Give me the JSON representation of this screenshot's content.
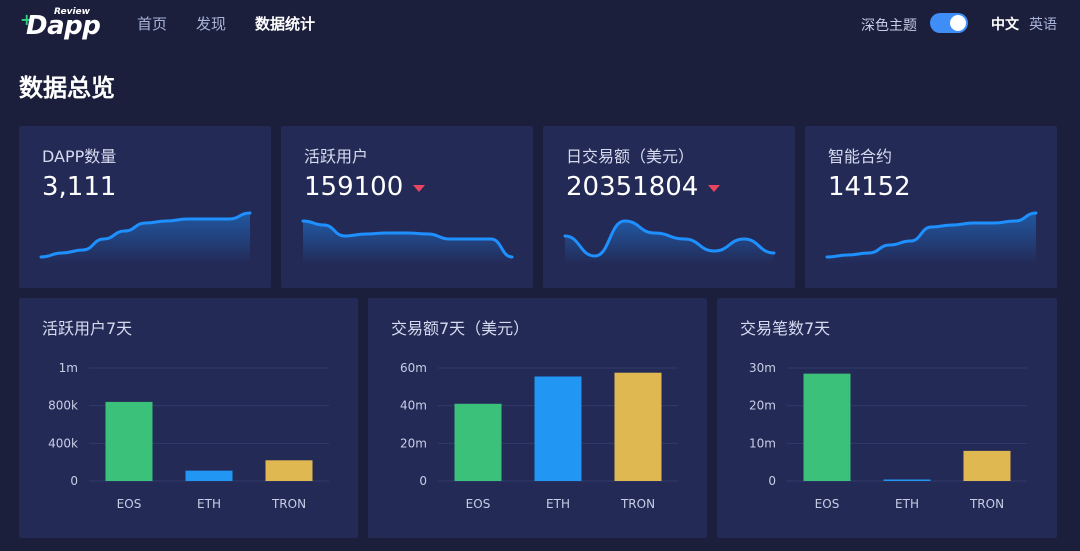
{
  "header": {
    "logo_main": "Dapp",
    "logo_sub": "Review",
    "nav": [
      {
        "label": "首页",
        "active": false
      },
      {
        "label": "发现",
        "active": false
      },
      {
        "label": "数据统计",
        "active": true
      }
    ],
    "theme_label": "深色主题",
    "dark_theme_on": true,
    "lang_zh": "中文",
    "lang_en": "英语"
  },
  "page_title": "数据总览",
  "colors": {
    "background": "#1b1f3b",
    "card": "#232a56",
    "accent_blue": "#1e90ff",
    "eos": "#3cc17a",
    "eth": "#2196f3",
    "tron": "#e0b852",
    "down": "#e94560"
  },
  "stats": [
    {
      "label": "DAPP数量",
      "value": "3,111",
      "trend": "none",
      "spark": [
        4,
        8,
        11,
        22,
        30,
        38,
        40,
        42,
        42,
        42,
        48
      ]
    },
    {
      "label": "活跃用户",
      "value": "159100",
      "trend": "down",
      "spark": [
        40,
        36,
        25,
        27,
        28,
        28,
        27,
        22,
        22,
        22,
        4
      ]
    },
    {
      "label": "日交易额（美元）",
      "value": "20351804",
      "trend": "down",
      "spark": [
        25,
        5,
        40,
        28,
        22,
        10,
        22,
        8
      ]
    },
    {
      "label": "智能合约",
      "value": "14152",
      "trend": "none",
      "spark": [
        4,
        6,
        8,
        16,
        20,
        34,
        36,
        38,
        38,
        40,
        48
      ]
    }
  ],
  "chart_data": [
    {
      "type": "bar",
      "title": "活跃用户7天",
      "categories": [
        "EOS",
        "ETH",
        "TRON"
      ],
      "values": [
        840000,
        110000,
        220000
      ],
      "ylim": [
        0,
        1200000
      ],
      "yticks": [
        0,
        400000,
        800000,
        1200000
      ],
      "ytick_labels": [
        "0",
        "400k",
        "800k",
        "1m"
      ],
      "grid": true
    },
    {
      "type": "bar",
      "title": "交易额7天（美元）",
      "categories": [
        "EOS",
        "ETH",
        "TRON"
      ],
      "values": [
        41000000,
        55500000,
        57500000
      ],
      "ylim": [
        0,
        60000000
      ],
      "yticks": [
        0,
        20000000,
        40000000,
        60000000
      ],
      "ytick_labels": [
        "0",
        "20m",
        "40m",
        "60m"
      ],
      "grid": true
    },
    {
      "type": "bar",
      "title": "交易笔数7天",
      "categories": [
        "EOS",
        "ETH",
        "TRON"
      ],
      "values": [
        28500000,
        300000,
        8000000
      ],
      "ylim": [
        0,
        30000000
      ],
      "yticks": [
        0,
        10000000,
        20000000,
        30000000
      ],
      "ytick_labels": [
        "0",
        "10m",
        "20m",
        "30m"
      ],
      "grid": true
    }
  ]
}
